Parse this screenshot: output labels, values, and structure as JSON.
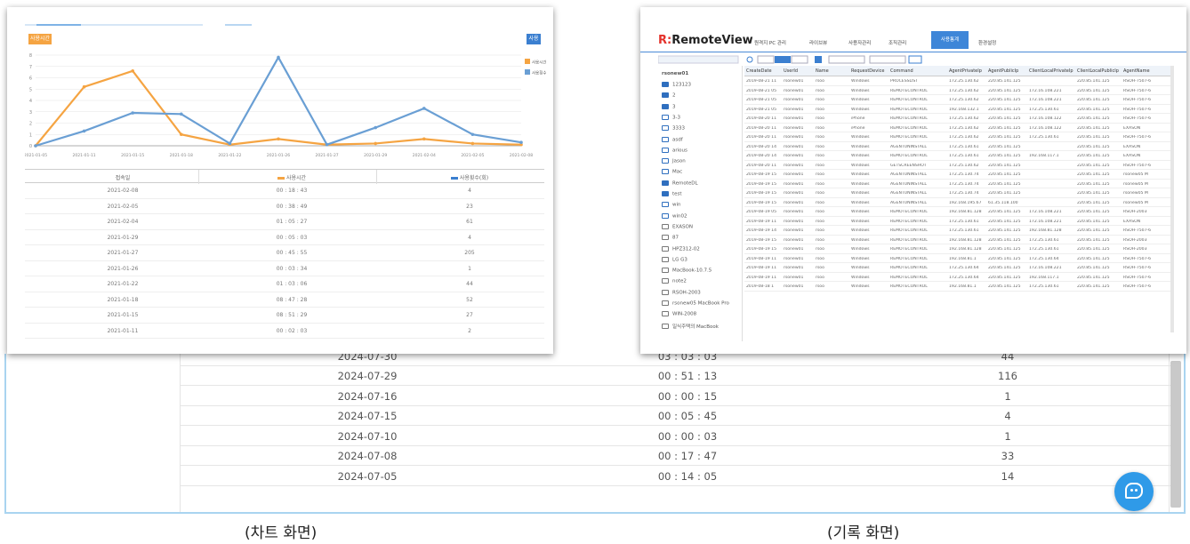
{
  "captions": {
    "left": "(차트 화면)",
    "right": "(기록 화면)"
  },
  "background_table": {
    "partial_row": {
      "date": "2024-07-30",
      "time": "03 : 03 : 03",
      "count": "44"
    },
    "rows": [
      {
        "date": "2024-07-29",
        "time": "00 : 51 : 13",
        "count": "116"
      },
      {
        "date": "2024-07-16",
        "time": "00 : 00 : 15",
        "count": "1"
      },
      {
        "date": "2024-07-15",
        "time": "00 : 05 : 45",
        "count": "4"
      },
      {
        "date": "2024-07-10",
        "time": "00 : 00 : 03",
        "count": "1"
      },
      {
        "date": "2024-07-08",
        "time": "00 : 17 : 47",
        "count": "33"
      },
      {
        "date": "2024-07-05",
        "time": "00 : 14 : 05",
        "count": "14"
      }
    ]
  },
  "chart_panel": {
    "tag": "사용시간",
    "button": "사용횟수",
    "legend": [
      "사용시간",
      "사용횟수"
    ],
    "table_header": {
      "col1": "접속일",
      "col2": "사용시간",
      "col3": "사용횟수(회)"
    },
    "table_rows": [
      {
        "date": "2021-02-08",
        "time": "00 : 18 : 43",
        "count": "4"
      },
      {
        "date": "2021-02-05",
        "time": "00 : 38 : 49",
        "count": "23"
      },
      {
        "date": "2021-02-04",
        "time": "01 : 05 : 27",
        "count": "61"
      },
      {
        "date": "2021-01-29",
        "time": "00 : 05 : 03",
        "count": "4"
      },
      {
        "date": "2021-01-27",
        "time": "00 : 45 : 55",
        "count": "205"
      },
      {
        "date": "2021-01-26",
        "time": "00 : 03 : 34",
        "count": "1"
      },
      {
        "date": "2021-01-22",
        "time": "01 : 03 : 06",
        "count": "44"
      },
      {
        "date": "2021-01-18",
        "time": "08 : 47 : 28",
        "count": "52"
      },
      {
        "date": "2021-01-15",
        "time": "08 : 51 : 29",
        "count": "27"
      },
      {
        "date": "2021-01-11",
        "time": "00 : 02 : 03",
        "count": "2"
      }
    ]
  },
  "chart_data": {
    "type": "line",
    "x": [
      "2021-01-05",
      "2021-01-11",
      "2021-01-15",
      "2021-01-18",
      "2021-01-22",
      "2021-01-26",
      "2021-01-27",
      "2021-01-29",
      "2021-02-04",
      "2021-02-05",
      "2021-02-08"
    ],
    "series": [
      {
        "name": "사용시간",
        "color": "#f5a442",
        "values": [
          0,
          5.2,
          6.6,
          1.0,
          0.1,
          0.6,
          0.1,
          0.2,
          0.6,
          0.2,
          0.1
        ]
      },
      {
        "name": "사용횟수",
        "color": "#6a9fd4",
        "values": [
          0,
          1.3,
          2.9,
          2.8,
          0.2,
          7.8,
          0.1,
          1.6,
          3.3,
          1.0,
          0.3
        ]
      }
    ],
    "ylim": [
      0,
      8
    ],
    "legend_position": "top-right",
    "grid": true
  },
  "rv_panel": {
    "logo_mark": "R:",
    "logo_text": "RemoteView",
    "nav": [
      "원격지 PC 관리",
      "라이브뷰",
      "사용자관리",
      "조직관리",
      "사용통계",
      "환경설정"
    ],
    "nav_active": "사용통계",
    "sidebar_root": "rsonew01",
    "sidebar_items": [
      "123123",
      "2",
      "3",
      "3-3",
      "3333",
      "asdf",
      "arious",
      "Jason",
      "Mac",
      "RemoteDL",
      "test",
      "win",
      "win02",
      "EXASON",
      "87",
      "HPZ312-02",
      "LG G3",
      "MacBook-10.7.5",
      "note2",
      "RSOH-2003",
      "rsonew05 MacBook Pro",
      "WIN-2008",
      "일식주택의 MacBook"
    ],
    "columns": [
      "CreateDate",
      "UserId",
      "Name",
      "RequestDevice",
      "Command",
      "AgentPrivateIp",
      "AgentPublicIp",
      "ClientLocalPrivateIp",
      "ClientLocalPublicIp",
      "AgentName"
    ],
    "rows": [
      [
        "2019-08-21 11",
        "rsonew01",
        "rsoo",
        "Windows",
        "PROCESSLIST",
        "172.25.130.62",
        "220.85.141.125",
        "",
        "220.85.141.125",
        "RSOH-7507-6"
      ],
      [
        "2019-08-21 05",
        "rsonew01",
        "rsoo",
        "Windows",
        "REMOTECONTROL",
        "172.25.130.62",
        "220.85.141.125",
        "172.16.108.221",
        "220.85.141.125",
        "RSOH-7507-6"
      ],
      [
        "2019-08-21 05",
        "rsonew01",
        "rsoo",
        "Windows",
        "REMOTECONTROL",
        "172.25.130.62",
        "220.85.141.125",
        "172.16.108.221",
        "220.85.141.125",
        "RSOH-7507-6"
      ],
      [
        "2019-08-21 05",
        "rsonew01",
        "rsoo",
        "Windows",
        "REMOTECONTROL",
        "192.168.132.1",
        "220.85.141.125",
        "172.25.130.61",
        "220.85.141.125",
        "RSOH-7507-6"
      ],
      [
        "2019-08-20 11",
        "rsonew01",
        "rsoo",
        "iPhone",
        "REMOTECONTROL",
        "172.25.130.62",
        "220.85.141.125",
        "172.16.108.122",
        "220.85.141.125",
        "RSOH-7507-6"
      ],
      [
        "2019-08-20 11",
        "rsonew01",
        "rsoo",
        "iPhone",
        "REMOTECONTROL",
        "172.25.130.62",
        "220.85.141.125",
        "172.16.108.122",
        "220.85.141.125",
        "EXASON"
      ],
      [
        "2019-08-20 11",
        "rsonew01",
        "rsoo",
        "Windows",
        "REMOTECONTROL",
        "172.25.130.62",
        "220.85.141.125",
        "172.25.130.61",
        "220.85.141.125",
        "RSOH-7507-6"
      ],
      [
        "2019-08-20 14",
        "rsonew01",
        "rsoo",
        "Windows",
        "AGENTUNINSTALL",
        "172.25.130.61",
        "220.85.141.125",
        "",
        "220.85.141.125",
        "EXASON"
      ],
      [
        "2019-08-20 14",
        "rsonew01",
        "rsoo",
        "Windows",
        "REMOTECONTROL",
        "172.25.130.61",
        "220.85.141.125",
        "192.168.117.1",
        "220.85.141.125",
        "EXASON"
      ],
      [
        "2019-08-20 11",
        "rsonew01",
        "rsoo",
        "Windows",
        "GETSCREENSHOT",
        "172.25.130.62",
        "220.85.141.125",
        "",
        "220.85.141.125",
        "RSOH-7507-6"
      ],
      [
        "2019-08-19 15",
        "rsonew01",
        "rsoo",
        "Windows",
        "AGENTUNINSTALL",
        "172.25.130.74",
        "220.85.141.125",
        "",
        "220.85.141.125",
        "rsonew05 M"
      ],
      [
        "2019-08-19 15",
        "rsonew01",
        "rsoo",
        "Windows",
        "AGENTUNINSTALL",
        "172.25.130.74",
        "220.85.141.125",
        "",
        "220.85.141.125",
        "rsonew05 M"
      ],
      [
        "2019-08-19 15",
        "rsonew01",
        "rsoo",
        "Windows",
        "AGENTUNINSTALL",
        "172.25.130.74",
        "220.85.141.125",
        "",
        "220.85.141.125",
        "rsonew05 M"
      ],
      [
        "2019-08-19 15",
        "rsonew01",
        "rsoo",
        "Windows",
        "AGENTUNINSTALL",
        "192.168.195.67",
        "61.35.118.100",
        "",
        "220.85.141.125",
        "rsonew05 M"
      ],
      [
        "2019-08-19 05",
        "rsonew01",
        "rsoo",
        "Windows",
        "REMOTECONTROL",
        "192.168.81.128",
        "220.85.141.125",
        "172.16.108.221",
        "220.85.141.125",
        "RSOH-2003"
      ],
      [
        "2019-08-19 11",
        "rsonew01",
        "rsoo",
        "Windows",
        "REMOTECONTROL",
        "172.25.130.61",
        "220.85.141.125",
        "172.16.108.221",
        "220.85.141.125",
        "EXASON"
      ],
      [
        "2019-08-19 14",
        "rsonew01",
        "rsoo",
        "Windows",
        "REMOTECONTROL",
        "172.25.130.61",
        "220.85.141.125",
        "192.168.81.128",
        "220.85.141.125",
        "RSOH-7507-6"
      ],
      [
        "2019-08-19 15",
        "rsonew01",
        "rsoo",
        "Windows",
        "REMOTECONTROL",
        "192.168.81.128",
        "220.85.141.125",
        "172.25.130.61",
        "220.85.141.125",
        "RSOH-2003"
      ],
      [
        "2019-08-19 15",
        "rsonew01",
        "rsoo",
        "Windows",
        "REMOTECONTROL",
        "192.168.81.128",
        "220.85.141.125",
        "172.25.130.61",
        "220.85.141.125",
        "RSOH-2003"
      ],
      [
        "2019-08-19 11",
        "rsonew01",
        "rsoo",
        "Windows",
        "REMOTECONTROL",
        "192.168.81.1",
        "220.85.141.125",
        "172.25.130.64",
        "220.85.141.125",
        "RSOH-7507-6"
      ],
      [
        "2019-08-19 11",
        "rsonew01",
        "rsoo",
        "Windows",
        "REMOTECONTROL",
        "172.25.130.64",
        "220.85.141.125",
        "172.16.108.221",
        "220.85.141.125",
        "RSOH-7507-6"
      ],
      [
        "2019-08-19 11",
        "rsonew01",
        "rsoo",
        "Windows",
        "REMOTECONTROL",
        "172.25.130.64",
        "220.85.141.125",
        "192.168.117.1",
        "220.85.141.125",
        "RSOH-7507-6"
      ],
      [
        "2019-08-18 1",
        "rsonew01",
        "rsoo",
        "Windows",
        "REMOTECONTROL",
        "192.168.81.1",
        "220.85.141.125",
        "172.25.130.61",
        "220.85.141.125",
        "RSOH-7507-6"
      ]
    ]
  }
}
